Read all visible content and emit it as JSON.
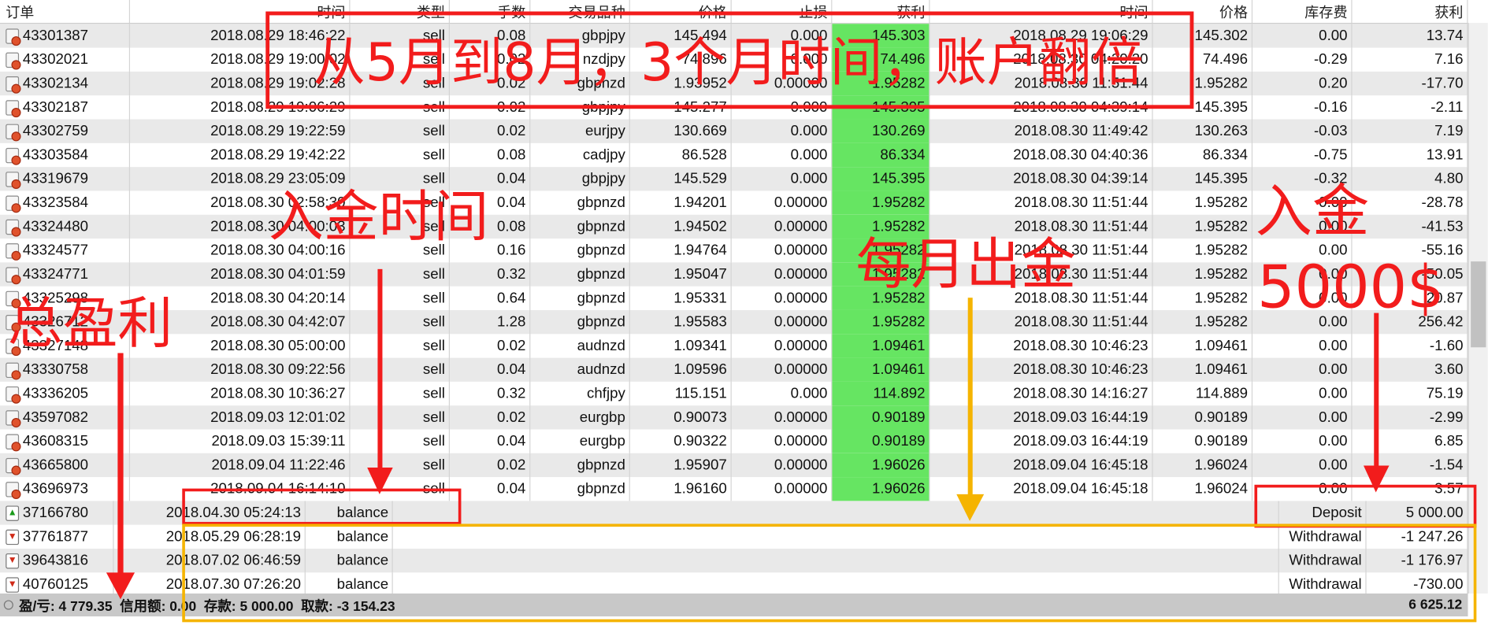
{
  "columns": [
    "订单",
    "时间",
    "类型",
    "手数",
    "交易品种",
    "价格",
    "止损",
    "获利",
    "时间",
    "价格",
    "库存费",
    "获利"
  ],
  "trades": [
    {
      "order": "43301387",
      "open_time": "2018.08.29 18:46:22",
      "type": "sell",
      "size": "0.08",
      "symbol": "gbpjpy",
      "open_price": "145.494",
      "sl": "0.000",
      "tp": "145.303",
      "close_time": "2018.08.29 19:06:29",
      "close_price": "145.302",
      "swap": "0.00",
      "profit": "13.74"
    },
    {
      "order": "43302021",
      "open_time": "2018.08.29 19:00:02",
      "type": "sell",
      "size": "0.02",
      "symbol": "nzdjpy",
      "open_price": "74.896",
      "sl": "0.000",
      "tp": "74.496",
      "close_time": "2018.08.30 04:20:20",
      "close_price": "74.496",
      "swap": "-0.29",
      "profit": "7.16"
    },
    {
      "order": "43302134",
      "open_time": "2018.08.29 19:02:28",
      "type": "sell",
      "size": "0.02",
      "symbol": "gbpnzd",
      "open_price": "1.93952",
      "sl": "0.00000",
      "tp": "1.95282",
      "close_time": "2018.08.30 11:51:44",
      "close_price": "1.95282",
      "swap": "0.20",
      "profit": "-17.70"
    },
    {
      "order": "43302187",
      "open_time": "2018.08.29 19:06:29",
      "type": "sell",
      "size": "0.02",
      "symbol": "gbpjpy",
      "open_price": "145.277",
      "sl": "0.000",
      "tp": "145.395",
      "close_time": "2018.08.30 04:39:14",
      "close_price": "145.395",
      "swap": "-0.16",
      "profit": "-2.11"
    },
    {
      "order": "43302759",
      "open_time": "2018.08.29 19:22:59",
      "type": "sell",
      "size": "0.02",
      "symbol": "eurjpy",
      "open_price": "130.669",
      "sl": "0.000",
      "tp": "130.269",
      "close_time": "2018.08.30 11:49:42",
      "close_price": "130.263",
      "swap": "-0.03",
      "profit": "7.19"
    },
    {
      "order": "43303584",
      "open_time": "2018.08.29 19:42:22",
      "type": "sell",
      "size": "0.08",
      "symbol": "cadjpy",
      "open_price": "86.528",
      "sl": "0.000",
      "tp": "86.334",
      "close_time": "2018.08.30 04:40:36",
      "close_price": "86.334",
      "swap": "-0.75",
      "profit": "13.91"
    },
    {
      "order": "43319679",
      "open_time": "2018.08.29 23:05:09",
      "type": "sell",
      "size": "0.04",
      "symbol": "gbpjpy",
      "open_price": "145.529",
      "sl": "0.000",
      "tp": "145.395",
      "close_time": "2018.08.30 04:39:14",
      "close_price": "145.395",
      "swap": "-0.32",
      "profit": "4.80"
    },
    {
      "order": "43323584",
      "open_time": "2018.08.30 02:58:30",
      "type": "sell",
      "size": "0.04",
      "symbol": "gbpnzd",
      "open_price": "1.94201",
      "sl": "0.00000",
      "tp": "1.95282",
      "close_time": "2018.08.30 11:51:44",
      "close_price": "1.95282",
      "swap": "0.00",
      "profit": "-28.78"
    },
    {
      "order": "43324480",
      "open_time": "2018.08.30 04:00:03",
      "type": "sell",
      "size": "0.08",
      "symbol": "gbpnzd",
      "open_price": "1.94502",
      "sl": "0.00000",
      "tp": "1.95282",
      "close_time": "2018.08.30 11:51:44",
      "close_price": "1.95282",
      "swap": "0.00",
      "profit": "-41.53"
    },
    {
      "order": "43324577",
      "open_time": "2018.08.30 04:00:16",
      "type": "sell",
      "size": "0.16",
      "symbol": "gbpnzd",
      "open_price": "1.94764",
      "sl": "0.00000",
      "tp": "1.95282",
      "close_time": "2018.08.30 11:51:44",
      "close_price": "1.95282",
      "swap": "0.00",
      "profit": "-55.16"
    },
    {
      "order": "43324771",
      "open_time": "2018.08.30 04:01:59",
      "type": "sell",
      "size": "0.32",
      "symbol": "gbpnzd",
      "open_price": "1.95047",
      "sl": "0.00000",
      "tp": "1.95282",
      "close_time": "2018.08.30 11:51:44",
      "close_price": "1.95282",
      "swap": "0.00",
      "profit": "-50.05"
    },
    {
      "order": "43325298",
      "open_time": "2018.08.30 04:20:14",
      "type": "sell",
      "size": "0.64",
      "symbol": "gbpnzd",
      "open_price": "1.95331",
      "sl": "0.00000",
      "tp": "1.95282",
      "close_time": "2018.08.30 11:51:44",
      "close_price": "1.95282",
      "swap": "0.00",
      "profit": "20.87"
    },
    {
      "order": "43326712",
      "open_time": "2018.08.30 04:42:07",
      "type": "sell",
      "size": "1.28",
      "symbol": "gbpnzd",
      "open_price": "1.95583",
      "sl": "0.00000",
      "tp": "1.95282",
      "close_time": "2018.08.30 11:51:44",
      "close_price": "1.95282",
      "swap": "0.00",
      "profit": "256.42"
    },
    {
      "order": "43327148",
      "open_time": "2018.08.30 05:00:00",
      "type": "sell",
      "size": "0.02",
      "symbol": "audnzd",
      "open_price": "1.09341",
      "sl": "0.00000",
      "tp": "1.09461",
      "close_time": "2018.08.30 10:46:23",
      "close_price": "1.09461",
      "swap": "0.00",
      "profit": "-1.60"
    },
    {
      "order": "43330758",
      "open_time": "2018.08.30 09:22:56",
      "type": "sell",
      "size": "0.04",
      "symbol": "audnzd",
      "open_price": "1.09596",
      "sl": "0.00000",
      "tp": "1.09461",
      "close_time": "2018.08.30 10:46:23",
      "close_price": "1.09461",
      "swap": "0.00",
      "profit": "3.60"
    },
    {
      "order": "43336205",
      "open_time": "2018.08.30 10:36:27",
      "type": "sell",
      "size": "0.32",
      "symbol": "chfjpy",
      "open_price": "115.151",
      "sl": "0.000",
      "tp": "114.892",
      "close_time": "2018.08.30 14:16:27",
      "close_price": "114.889",
      "swap": "0.00",
      "profit": "75.19"
    },
    {
      "order": "43597082",
      "open_time": "2018.09.03 12:01:02",
      "type": "sell",
      "size": "0.02",
      "symbol": "eurgbp",
      "open_price": "0.90073",
      "sl": "0.00000",
      "tp": "0.90189",
      "close_time": "2018.09.03 16:44:19",
      "close_price": "0.90189",
      "swap": "0.00",
      "profit": "-2.99"
    },
    {
      "order": "43608315",
      "open_time": "2018.09.03 15:39:11",
      "type": "sell",
      "size": "0.04",
      "symbol": "eurgbp",
      "open_price": "0.90322",
      "sl": "0.00000",
      "tp": "0.90189",
      "close_time": "2018.09.03 16:44:19",
      "close_price": "0.90189",
      "swap": "0.00",
      "profit": "6.85"
    },
    {
      "order": "43665800",
      "open_time": "2018.09.04 11:22:46",
      "type": "sell",
      "size": "0.02",
      "symbol": "gbpnzd",
      "open_price": "1.95907",
      "sl": "0.00000",
      "tp": "1.96026",
      "close_time": "2018.09.04 16:45:18",
      "close_price": "1.96024",
      "swap": "0.00",
      "profit": "-1.54"
    },
    {
      "order": "43696973",
      "open_time": "2018.09.04 16:14:10",
      "type": "sell",
      "size": "0.04",
      "symbol": "gbpnzd",
      "open_price": "1.96160",
      "sl": "0.00000",
      "tp": "1.96026",
      "close_time": "2018.09.04 16:45:18",
      "close_price": "1.96024",
      "swap": "0.00",
      "profit": "3.57"
    }
  ],
  "balance_ops": [
    {
      "order": "37166780",
      "time": "2018.04.30 05:24:13",
      "type": "balance",
      "comment": "Deposit",
      "amount": "5 000.00",
      "kind": "deposit"
    },
    {
      "order": "37761877",
      "time": "2018.05.29 06:28:19",
      "type": "balance",
      "comment": "Withdrawal",
      "amount": "-1 247.26",
      "kind": "withdrawal"
    },
    {
      "order": "39643816",
      "time": "2018.07.02 06:46:59",
      "type": "balance",
      "comment": "Withdrawal",
      "amount": "-1 176.97",
      "kind": "withdrawal"
    },
    {
      "order": "40760125",
      "time": "2018.07.30 07:26:20",
      "type": "balance",
      "comment": "Withdrawal",
      "amount": "-730.00",
      "kind": "withdrawal"
    }
  ],
  "summary": {
    "pl": "盈/亏: 4 779.35",
    "credit": "信用额: 0.00",
    "deposit": "存款: 5 000.00",
    "withdrawal": "取款: -3 154.23",
    "total": "6 625.12"
  },
  "annotations": {
    "headline": "从5月到8月，3个月时间，账户翻倍",
    "deposit_time": "入金时间",
    "monthly_withdrawal": "每月出金",
    "deposit_label": "入金",
    "deposit_amount": "5000$",
    "total_profit": "总盈利"
  },
  "colors": {
    "tp_highlight": "#66e562",
    "row_alt": "#e9e9e9",
    "summary_bar": "#c8c8c8",
    "annotation_red": "#f21c1c",
    "annotation_yellow": "#f5b400"
  }
}
